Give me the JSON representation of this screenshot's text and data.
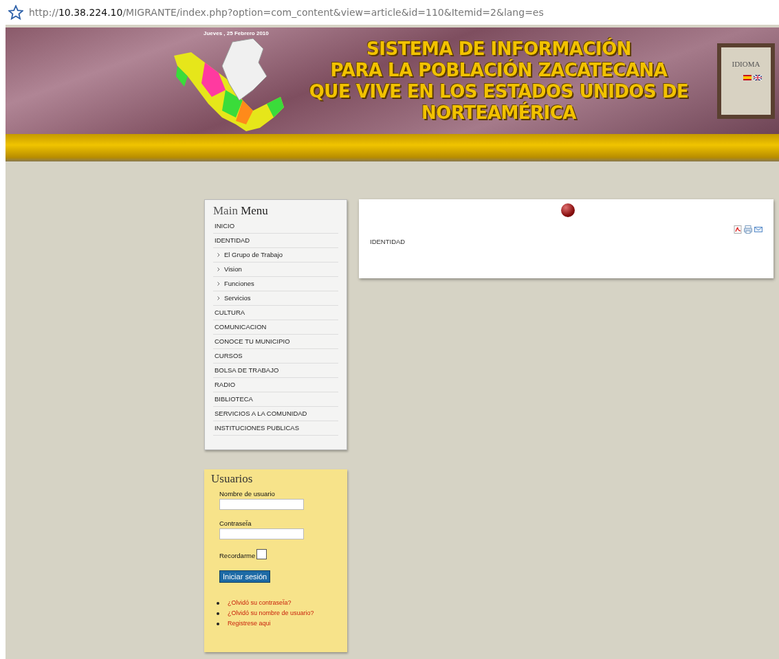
{
  "address_bar": {
    "url_prefix": "http://",
    "url_host": "10.38.224.10",
    "url_path": "/MIGRANTE/index.php?option=com_content&view=article&id=110&Itemid=2&lang=es"
  },
  "header": {
    "date": "Jueves , 25 Febrero 2010",
    "title_lines": [
      "SISTEMA DE INFORMACIÓN",
      "PARA LA POBLACIÓN ZACATECANA",
      "QUE VIVE EN LOS ESTADOS UNIDOS DE",
      "NORTEAMÉRICA"
    ],
    "language_box": {
      "title": "IDIOMA"
    }
  },
  "main_menu": {
    "title_light": "Main",
    "title_strong": "Menu",
    "items": [
      {
        "label": "INICIO"
      },
      {
        "label": "IDENTIDAD",
        "children": [
          {
            "label": "El Grupo de Trabajo"
          },
          {
            "label": "Vision"
          },
          {
            "label": "Funciones"
          },
          {
            "label": "Servicios"
          }
        ]
      },
      {
        "label": "CULTURA"
      },
      {
        "label": "COMUNICACION"
      },
      {
        "label": "CONOCE TU MUNICIPIO"
      },
      {
        "label": "CURSOS"
      },
      {
        "label": "BOLSA DE TRABAJO"
      },
      {
        "label": "RADIO"
      },
      {
        "label": "BIBLIOTECA"
      },
      {
        "label": "SERVICIOS A LA COMUNIDAD"
      },
      {
        "label": "INSTITUCIONES PUBLICAS"
      }
    ]
  },
  "login": {
    "title": "Usuarios",
    "username_label": "Nombre de usuario",
    "password_label": "ContraseÏa",
    "remember_label": "Recordarme",
    "remember_checked": false,
    "submit": "Iniciar sesión",
    "links": [
      "¿Olvidó su contraseÏa?",
      "¿Olvidó su nombre de usuario?",
      "Registrese aqui"
    ]
  },
  "article": {
    "text": "IDENTIDAD"
  }
}
